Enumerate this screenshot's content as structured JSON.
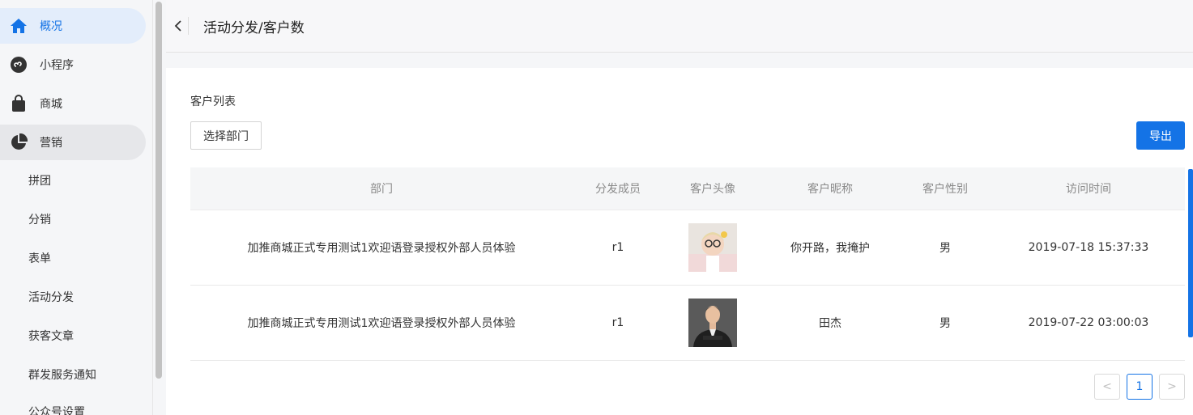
{
  "sidebar": {
    "items": [
      {
        "label": "概况",
        "icon": "home-icon"
      },
      {
        "label": "小程序",
        "icon": "mini-program-icon"
      },
      {
        "label": "商城",
        "icon": "shopping-bag-icon"
      },
      {
        "label": "营销",
        "icon": "pie-chart-icon"
      }
    ],
    "subitems": [
      "拼团",
      "分销",
      "表单",
      "活动分发",
      "获客文章",
      "群发服务通知",
      "公众号设置"
    ]
  },
  "header": {
    "title": "活动分发/客户数"
  },
  "main": {
    "section_title": "客户列表",
    "select_dept_label": "选择部门",
    "export_label": "导出",
    "columns": [
      "部门",
      "分发成员",
      "客户头像",
      "客户昵称",
      "客户性别",
      "访问时间"
    ],
    "rows": [
      {
        "dept": "加推商城正式专用测试1欢迎语登录授权外部人员体验",
        "member": "r1",
        "nickname": "你开路，我掩护",
        "gender": "男",
        "time": "2019-07-18 15:37:33"
      },
      {
        "dept": "加推商城正式专用测试1欢迎语登录授权外部人员体验",
        "member": "r1",
        "nickname": "田杰",
        "gender": "男",
        "time": "2019-07-22 03:00:03"
      }
    ]
  },
  "pagination": {
    "prev": "<",
    "current": "1",
    "next": ">"
  },
  "colors": {
    "accent": "#1473e6"
  }
}
